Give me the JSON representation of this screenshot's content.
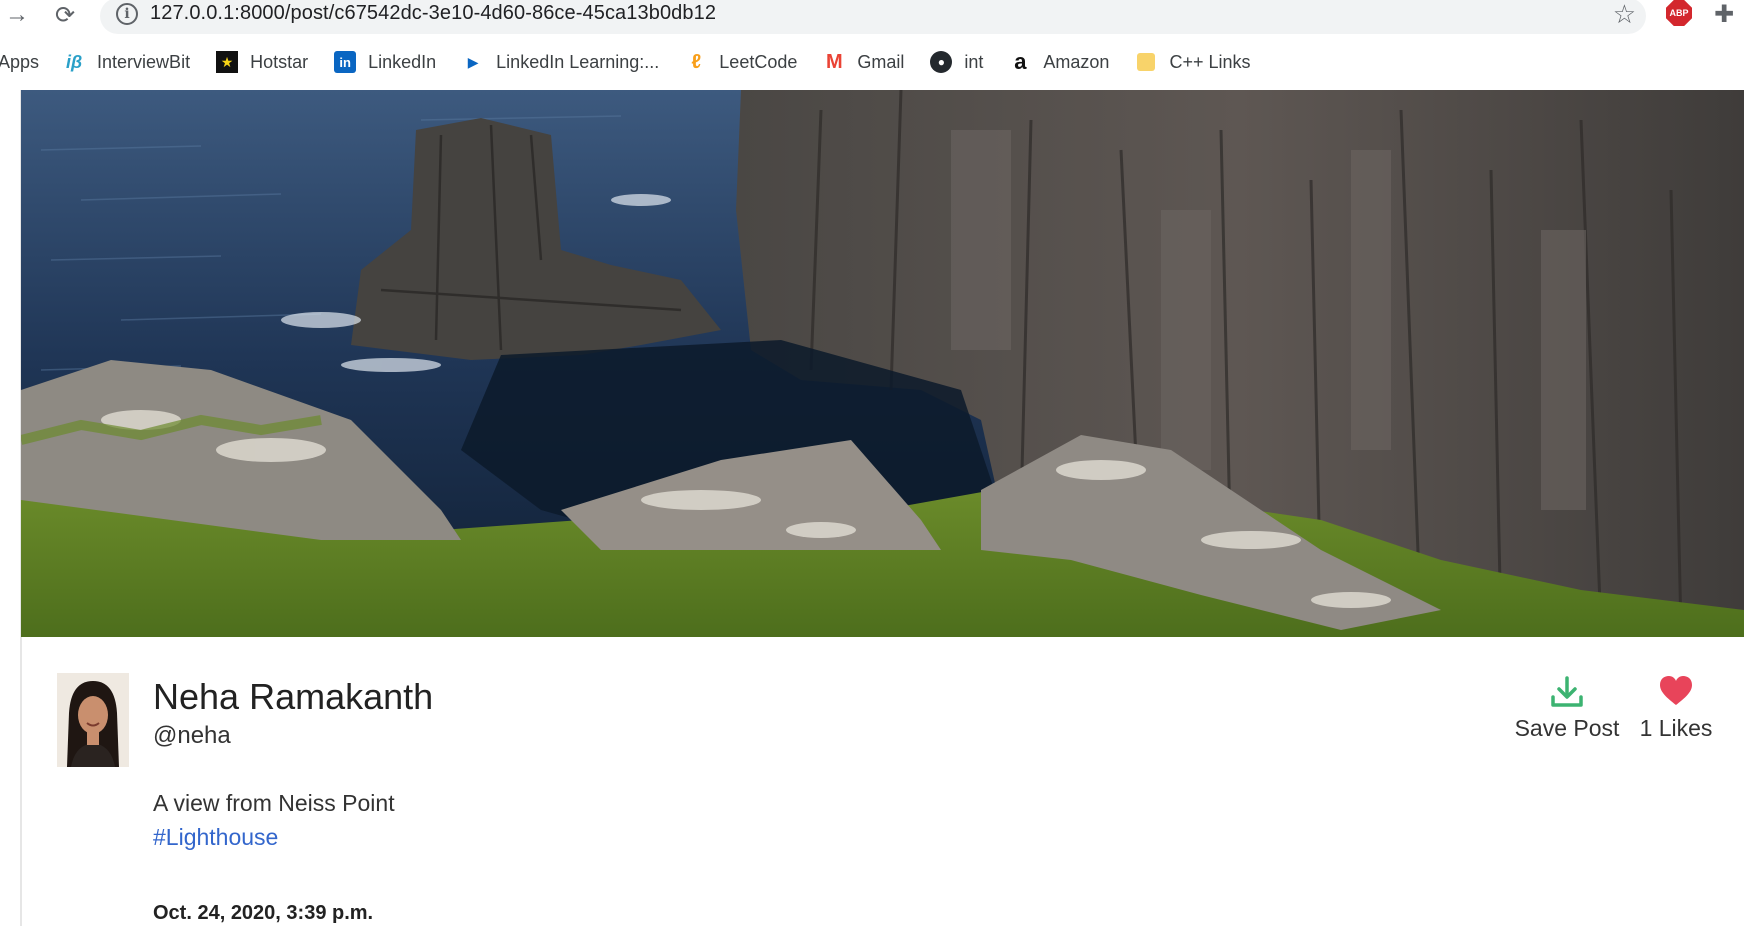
{
  "browser": {
    "url": "127.0.0.1:8000/post/c67542dc-3e10-4d60-86ce-45ca13b0db12",
    "bookmarks": [
      {
        "label": "Apps",
        "icon": "apps-icon"
      },
      {
        "label": "InterviewBit",
        "icon": "interviewbit-icon"
      },
      {
        "label": "Hotstar",
        "icon": "hotstar-icon"
      },
      {
        "label": "LinkedIn",
        "icon": "linkedin-icon"
      },
      {
        "label": "LinkedIn Learning:...",
        "icon": "linkedin-learning-icon"
      },
      {
        "label": "LeetCode",
        "icon": "leetcode-icon"
      },
      {
        "label": "Gmail",
        "icon": "gmail-icon"
      },
      {
        "label": "int",
        "icon": "github-icon"
      },
      {
        "label": "Amazon",
        "icon": "amazon-icon"
      },
      {
        "label": "C++ Links",
        "icon": "folder-icon"
      }
    ]
  },
  "post": {
    "author_name": "Neha Ramakanth",
    "author_handle": "@neha",
    "caption": "A view from Neiss Point",
    "hashtag": "#Lighthouse",
    "date": "Oct. 24, 2020, 3:39 p.m.",
    "save_label": "Save Post",
    "likes_label": "1 Likes"
  },
  "colors": {
    "save_icon": "#3cb371",
    "heart_icon": "#e8445a",
    "hashtag": "#3366cc"
  }
}
